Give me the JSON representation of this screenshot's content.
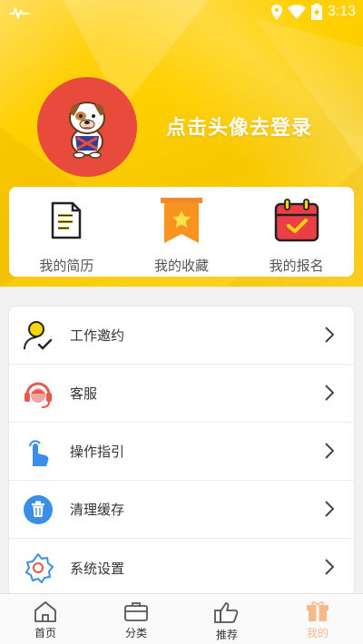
{
  "status_bar": {
    "time": "3:13"
  },
  "profile": {
    "login_prompt": "点击头像去登录"
  },
  "quick_actions": [
    {
      "label": "我的简历",
      "icon": "resume-icon"
    },
    {
      "label": "我的收藏",
      "icon": "favorite-bookmark-icon"
    },
    {
      "label": "我的报名",
      "icon": "calendar-check-icon"
    }
  ],
  "menu": [
    {
      "label": "工作邀约",
      "icon": "job-invite-icon"
    },
    {
      "label": "客服",
      "icon": "customer-service-icon"
    },
    {
      "label": "操作指引",
      "icon": "tap-guide-icon"
    },
    {
      "label": "清理缓存",
      "icon": "trash-icon"
    },
    {
      "label": "系统设置",
      "icon": "settings-icon"
    }
  ],
  "tabbar": {
    "items": [
      {
        "label": "首页",
        "icon": "home-icon"
      },
      {
        "label": "分类",
        "icon": "briefcase-icon"
      },
      {
        "label": "推荐",
        "icon": "thumbs-up-icon"
      },
      {
        "label": "我的",
        "icon": "gift-icon"
      }
    ],
    "active_index": 3,
    "active_color": "#f6b98c"
  },
  "colors": {
    "header_yellow": "#ffd000",
    "avatar_red": "#e84a3c"
  }
}
